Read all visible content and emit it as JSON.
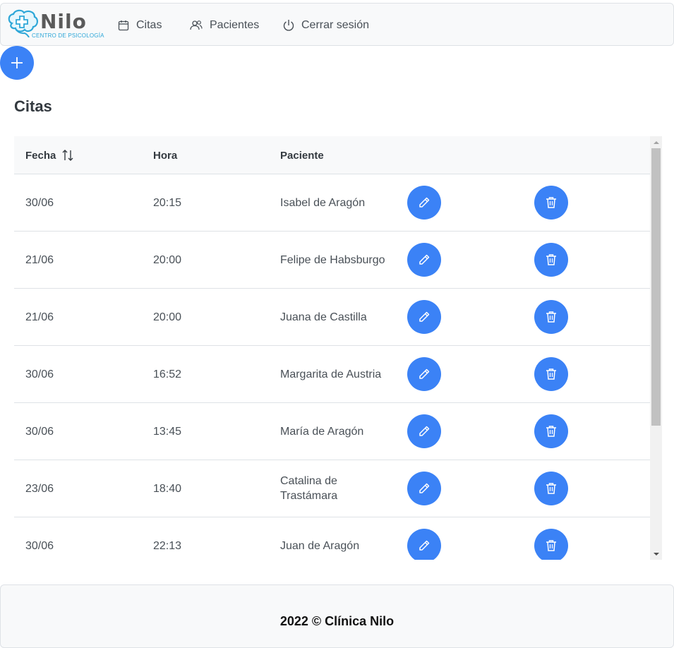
{
  "brand": {
    "name": "Nilo",
    "subtitle": "CENTRO DE PSICOLOGÍA",
    "accent": "#3b82f6",
    "logo_color": "#2ea7d8"
  },
  "nav": [
    {
      "label": "Citas",
      "icon": "calendar-icon"
    },
    {
      "label": "Pacientes",
      "icon": "users-icon"
    },
    {
      "label": "Cerrar sesión",
      "icon": "power-icon"
    }
  ],
  "add_button": {
    "icon": "plus-icon"
  },
  "page_title": "Citas",
  "table": {
    "columns": [
      "Fecha",
      "Hora",
      "Paciente"
    ],
    "sort_icon": "sort-alt-icon",
    "rows": [
      {
        "fecha": "30/06",
        "hora": "20:15",
        "paciente": "Isabel de Aragón"
      },
      {
        "fecha": "21/06",
        "hora": "20:00",
        "paciente": "Felipe de Habsburgo"
      },
      {
        "fecha": "21/06",
        "hora": "20:00",
        "paciente": "Juana de Castilla"
      },
      {
        "fecha": "30/06",
        "hora": "16:52",
        "paciente": "Margarita de Austria"
      },
      {
        "fecha": "30/06",
        "hora": "13:45",
        "paciente": "María de Aragón"
      },
      {
        "fecha": "23/06",
        "hora": "18:40",
        "paciente": "Catalina de Trastámara"
      },
      {
        "fecha": "30/06",
        "hora": "22:13",
        "paciente": "Juan de Aragón"
      }
    ],
    "row_actions": [
      {
        "icon": "pencil-icon"
      },
      {
        "icon": "trash-icon"
      }
    ]
  },
  "footer": {
    "text": "2022 © Clínica Nilo"
  }
}
